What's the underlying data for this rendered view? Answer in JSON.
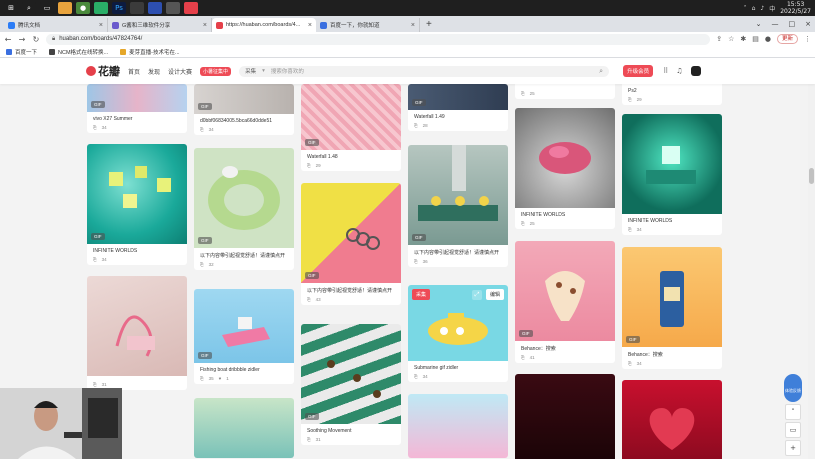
{
  "taskbar": {
    "clock_time": "15:53",
    "clock_date": "2022/5/27",
    "tray_lang": "中"
  },
  "browser": {
    "tabs": [
      {
        "title": "腾讯文档",
        "color": "#2b7cf6",
        "active": false
      },
      {
        "title": "G酱和三维软件分享",
        "color": "#6a5acd",
        "active": false
      },
      {
        "title": "https://huaban.com/boards/4...",
        "color": "#e5404a",
        "active": true
      },
      {
        "title": "百度一下，你就知道",
        "color": "#3a6fe0",
        "active": false
      }
    ],
    "url": "huaban.com/boards/47824764/",
    "update_label": "更新"
  },
  "bookmarks": [
    {
      "label": "百度一下",
      "color": "#3a6fe0"
    },
    {
      "label": "NCM格式在线转换...",
      "color": "#444444"
    },
    {
      "label": "麦芽直播-技术宅在...",
      "color": "#e5a72a"
    }
  ],
  "header": {
    "logo": "花瓣",
    "nav": [
      "首页",
      "发现",
      "设计大赛"
    ],
    "nav_badge": "小暑征集中",
    "search_type": "采集",
    "search_placeholder": "搜索你喜欢的",
    "upload_label": "升级会员"
  },
  "pins": {
    "col1": [
      {
        "caption": "vivo X27 Summer",
        "saves": "34",
        "gif": "GIF"
      },
      {
        "caption": "INFINITE WORLDS",
        "saves": "34",
        "gif": "GIF"
      },
      {
        "caption": "",
        "saves": "31",
        "gif": ""
      }
    ],
    "col2": [
      {
        "caption": "d0bbf06834005.5bca66d0dde51",
        "saves": "34",
        "gif": "GIF"
      },
      {
        "caption": "以下内容带引起视觉舒适！请谨慎点开",
        "saves": "32",
        "gif": "GIF"
      },
      {
        "caption": "Fishing boat dribbble zidler",
        "saves": "35",
        "likes": "1",
        "gif": "GIF"
      }
    ],
    "col3": [
      {
        "caption": "Waterfall 1.48",
        "saves": "29",
        "gif": "GIF"
      },
      {
        "caption": "以下内容带引起视觉舒适！请谨慎点开",
        "saves": "43",
        "gif": "GIF"
      },
      {
        "caption": "Soothing Movement",
        "saves": "31",
        "gif": "GIF"
      }
    ],
    "col4": [
      {
        "caption": "Waterfall 1.49",
        "saves": "28",
        "gif": "GIF"
      },
      {
        "caption": "以下内容带引起视觉舒适！请谨慎点开",
        "saves": "36",
        "gif": "GIF"
      },
      {
        "caption": "Submarine gif zidler",
        "saves": "34",
        "gif": "",
        "collect": "采集",
        "edit": "编辑"
      }
    ],
    "col5": [
      {
        "caption": "",
        "saves": "25",
        "gif": ""
      },
      {
        "caption": "INFINITE WORLDS",
        "saves": "25",
        "gif": "GIF"
      },
      {
        "caption": "Behance：搜索",
        "saves": "41",
        "gif": "GIF"
      }
    ],
    "col6": [
      {
        "caption": "Ps2",
        "saves": "29",
        "gif": ""
      },
      {
        "caption": "INFINITE WORLDS",
        "saves": "34",
        "gif": "GIF"
      },
      {
        "caption": "Behance：搜索",
        "saves": "34",
        "gif": "GIF"
      }
    ]
  },
  "floating": {
    "feedback_label": "体验反馈"
  },
  "icons": [
    "search-icon",
    "back-icon",
    "forward-icon",
    "reload-icon",
    "home-icon",
    "close-icon",
    "bookmark-icon",
    "save-icon",
    "like-icon",
    "arrow-up-icon",
    "comment-icon",
    "grid-icon",
    "bell-icon"
  ]
}
